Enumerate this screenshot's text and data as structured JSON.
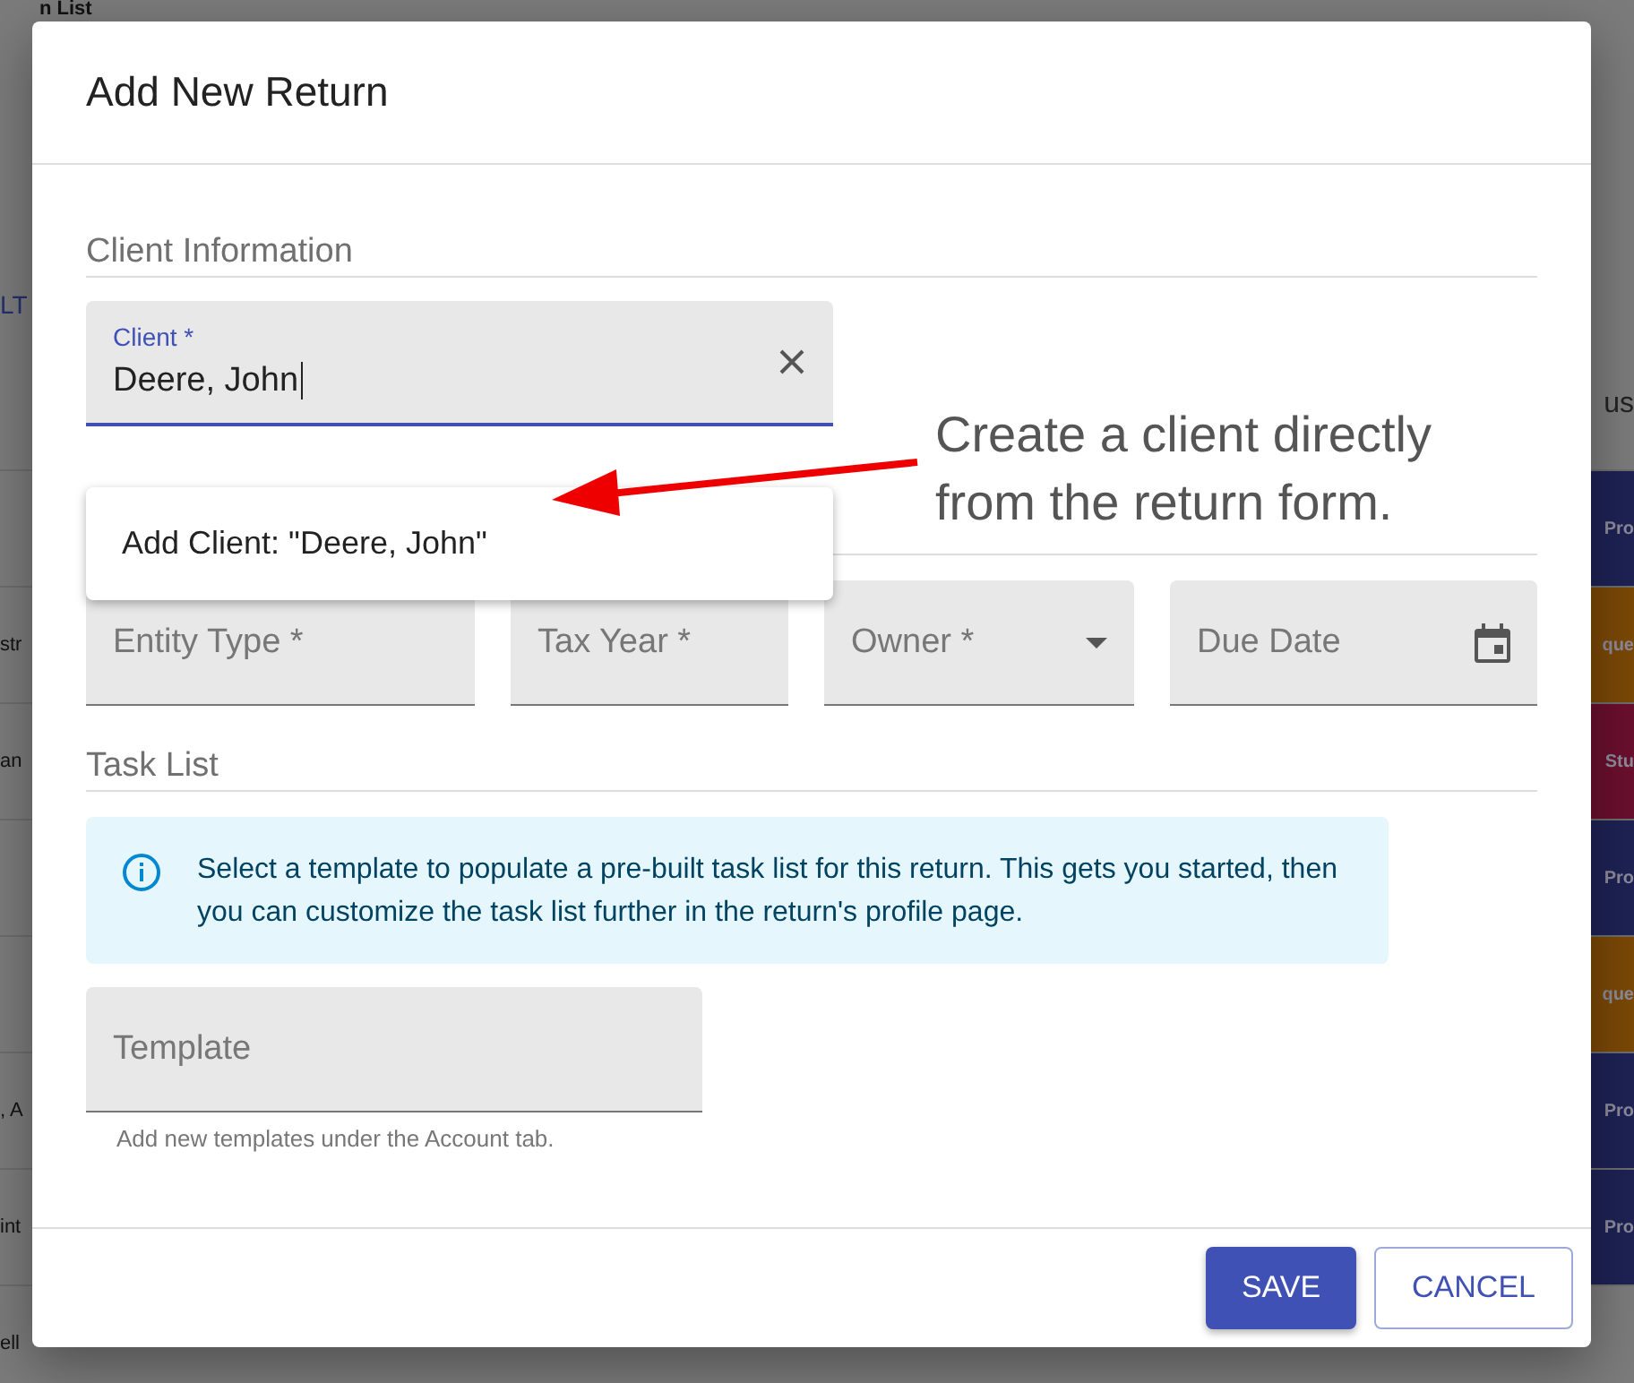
{
  "background": {
    "title": "n List",
    "link": "LT",
    "column_header": "us",
    "rows": [
      {
        "status": {
          "label": "Pro",
          "color": "#1e2254"
        }
      },
      {
        "cell": "str",
        "status": {
          "label": "que",
          "color": "#7a4806"
        }
      },
      {
        "cell": "an",
        "status": {
          "label": "Stu",
          "color": "#6a0f2e"
        }
      },
      {
        "status": {
          "label": "Pro",
          "color": "#1e2254"
        }
      },
      {
        "status": {
          "label": "que",
          "color": "#7a4806"
        }
      },
      {
        "cell": ", A",
        "status": {
          "label": "Pro",
          "color": "#1e2254"
        }
      },
      {
        "cell": "int",
        "status": {
          "label": "Pro",
          "color": "#1e2254"
        }
      },
      {
        "cell": "ell"
      }
    ]
  },
  "dialog": {
    "title": "Add New Return",
    "sections": [
      {
        "title": "Client Information"
      },
      {
        "title": "Task List"
      }
    ],
    "client_field": {
      "label": "Client *",
      "value": "Deere, John",
      "focused": true
    },
    "client_menu": {
      "items": [
        "Add Client: \"Deere, John\""
      ]
    },
    "fields": [
      {
        "kind": "text",
        "label": "Entity Type *"
      },
      {
        "kind": "text",
        "label": "Tax Year *"
      },
      {
        "kind": "select",
        "label": "Owner *"
      },
      {
        "kind": "date",
        "label": "Due Date"
      }
    ],
    "info_alert": "Select a template to populate a pre-built task list for this return. This gets you started, then you can customize the task list further in the return's profile page.",
    "template_field": {
      "label": "Template",
      "helper": "Add new templates under the Account tab."
    },
    "buttons": [
      {
        "kind": "primary",
        "label": "SAVE"
      },
      {
        "kind": "outlined",
        "label": "CANCEL"
      }
    ]
  },
  "annotation": {
    "lines": [
      "Create a client directly",
      "from the return form."
    ]
  }
}
